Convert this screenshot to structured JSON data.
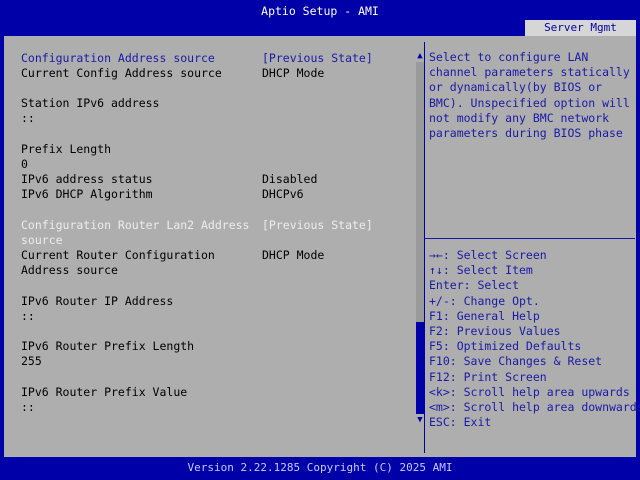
{
  "title": "Aptio Setup - AMI",
  "tab": "Server Mgmt",
  "items": [
    {
      "label": "Configuration Address source",
      "value": "[Previous State]",
      "style": "blue"
    },
    {
      "label": "Current Config Address source",
      "value": "DHCP Mode",
      "style": "normal"
    },
    {
      "label": "Station IPv6 address",
      "value": "",
      "style": "normal"
    },
    {
      "label": "::",
      "value": "",
      "style": "normal"
    },
    {
      "label": "Prefix Length",
      "value": "",
      "style": "normal"
    },
    {
      "label": "0",
      "value": "",
      "style": "normal"
    },
    {
      "label": "IPv6 address status",
      "value": "Disabled",
      "style": "normal"
    },
    {
      "label": "IPv6 DHCP Algorithm",
      "value": "DHCPv6",
      "style": "normal"
    },
    {
      "label": "Configuration Router Lan2 Address",
      "value": "[Previous State]",
      "style": "white"
    },
    {
      "label": "source",
      "value": "",
      "style": "white"
    },
    {
      "label": "Current Router Configuration",
      "value": "DHCP Mode",
      "style": "normal"
    },
    {
      "label": "Address source",
      "value": "",
      "style": "normal"
    },
    {
      "label": "IPv6 Router IP Address",
      "value": "",
      "style": "normal"
    },
    {
      "label": "::",
      "value": "",
      "style": "normal"
    },
    {
      "label": "IPv6 Router Prefix Length",
      "value": "",
      "style": "normal"
    },
    {
      "label": "255",
      "value": "",
      "style": "normal"
    },
    {
      "label": "IPv6 Router Prefix Value",
      "value": "",
      "style": "normal"
    },
    {
      "label": "::",
      "value": "",
      "style": "normal"
    }
  ],
  "help_text": [
    "Select to configure LAN",
    "channel parameters statically",
    "or dynamically(by BIOS or",
    "BMC). Unspecified option will",
    "not modify any BMC network",
    "parameters during BIOS phase"
  ],
  "keys": [
    "→←: Select Screen",
    "↑↓: Select Item",
    "Enter: Select",
    "+/-: Change Opt.",
    "F1: General Help",
    "F2: Previous Values",
    "F5: Optimized Defaults",
    "F10: Save Changes & Reset",
    "F12: Print Screen",
    "<k>: Scroll help area upwards",
    "<m>: Scroll help area downwards",
    "ESC: Exit"
  ],
  "footer": "Version 2.22.1285 Copyright (C) 2025 AMI",
  "colors": {
    "background": "#0000a8",
    "panel": "#aeaeae",
    "highlight": "#1a1aa6",
    "selected": "#ededed"
  }
}
